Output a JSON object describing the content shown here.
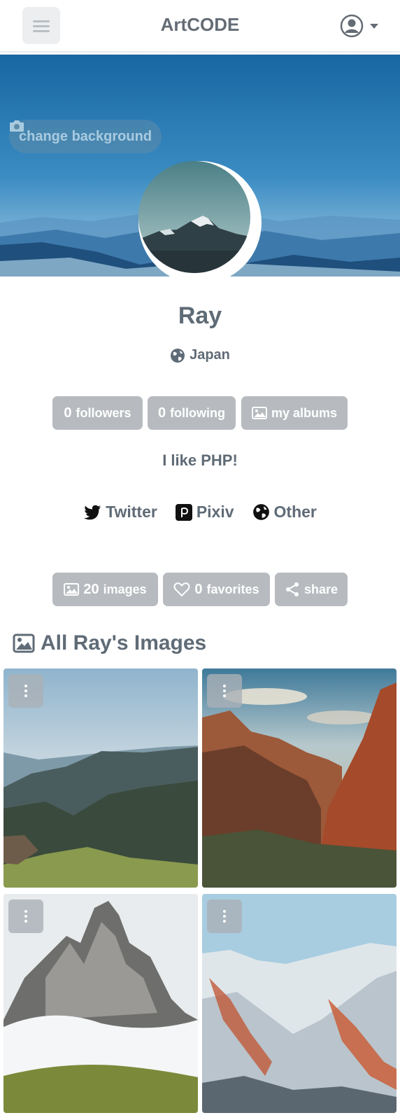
{
  "app": {
    "title": "ArtCODE"
  },
  "cover": {
    "change_background_label": "change background"
  },
  "profile": {
    "name": "Ray",
    "location": "Japan",
    "bio": "I like PHP!"
  },
  "stats": {
    "followers_count": "0",
    "followers_label": "followers",
    "following_count": "0",
    "following_label": "following",
    "albums_label": "my albums"
  },
  "socials": [
    {
      "label": "Twitter",
      "icon": "twitter-icon"
    },
    {
      "label": "Pixiv",
      "icon": "pixiv-icon"
    },
    {
      "label": "Other",
      "icon": "globe-icon"
    }
  ],
  "actions": {
    "images_count": "20",
    "images_label": "images",
    "favorites_count": "0",
    "favorites_label": "favorites",
    "share_label": "share"
  },
  "gallery": {
    "title": "All Ray's Images",
    "items": [
      {
        "subject": "valley mountains"
      },
      {
        "subject": "red canyon"
      },
      {
        "subject": "misty peak"
      },
      {
        "subject": "snowy slopes"
      }
    ]
  },
  "colors": {
    "button_gray": "#b7bbbf",
    "text": "#5f6b76",
    "cover_sky": "#1a6fa8"
  }
}
